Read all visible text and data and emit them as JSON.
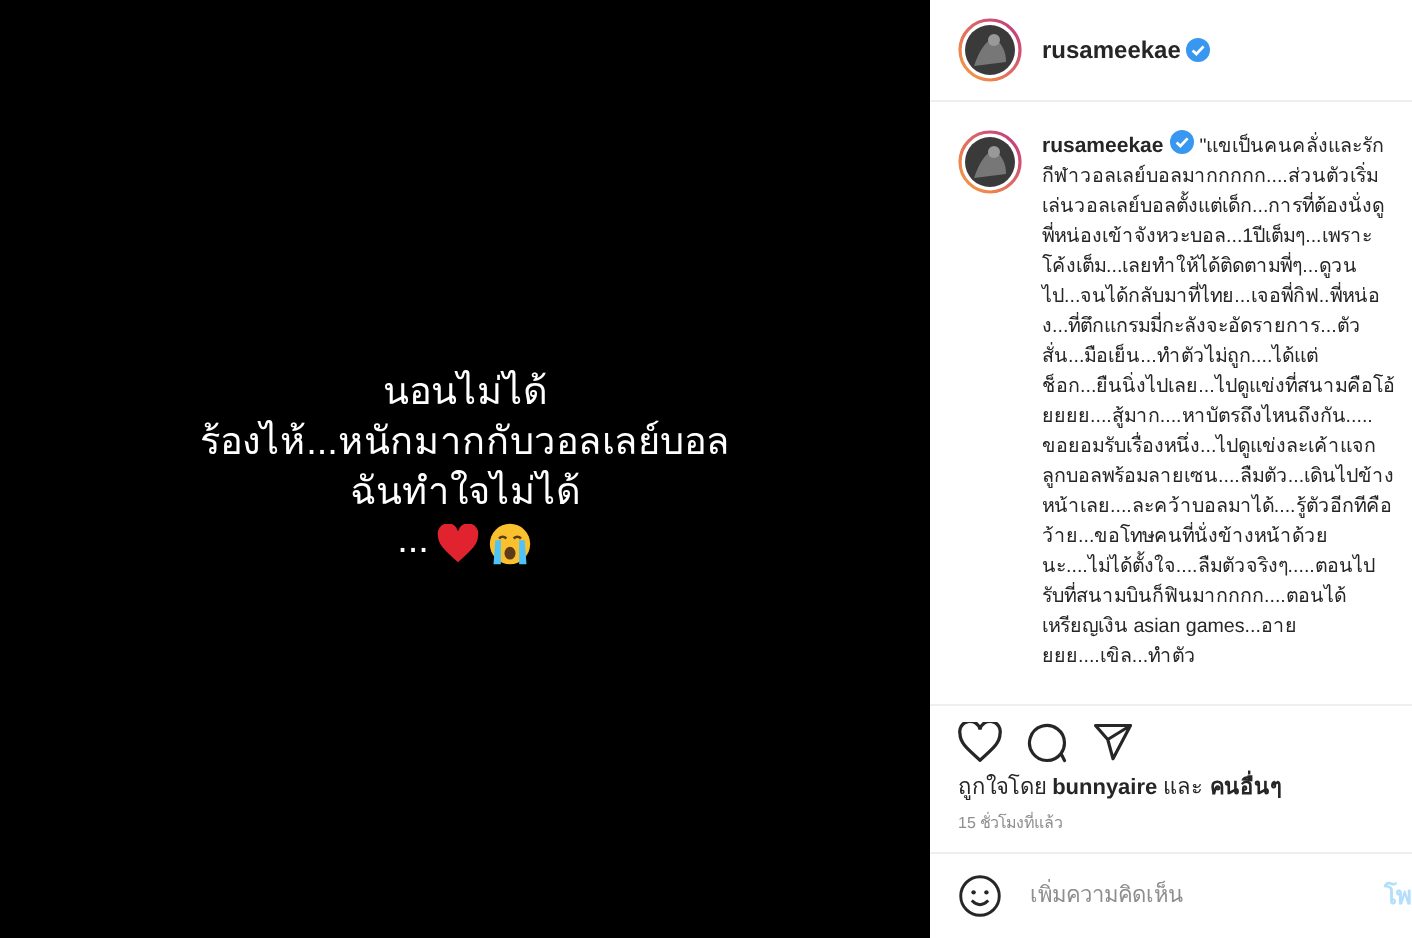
{
  "post_image": {
    "lines": [
      "นอนไม่ได้",
      "ร้องไห้...หนักมากกับวอลเลย์บอล",
      "ฉันทำใจไม่ได้",
      "..."
    ]
  },
  "header": {
    "username": "rusameekae",
    "verified": true
  },
  "caption": {
    "username": "rusameekae",
    "verified": true,
    "text": "\"แขเป็นคนคลั่งและรักกีฬาวอลเลย์บอลมากกกกก....ส่วนตัวเริ่มเล่นวอลเลย์บอลตั้งแต่เด็ก...การที่ต้องนั่งดูพี่หน่องเข้าจังหวะบอล...1ปีเต็มๆ...เพราะโค้งเต็ม...เลยทำให้ได้ติดตามพี่ๆ...ดูวนไป...จนได้กลับมาที่ไทย...เจอพี่กิฟ..พี่หน่อง...ที่ตึกแกรมมี่กะลังจะอัดรายการ...ตัวสั่น...มือเย็น...ทำตัวไม่ถูก....ได้แต่ช็อก...ยืนนิ่งไปเลย...ไปดูแข่งที่สนามคือโอ้ยยยย....สู้มาก....หาบัตรถึงไหนถึงกัน..... ขอยอมรับเรื่องหนึ่ง...ไปดูแข่งละเค้าแจกลูกบอลพร้อมลายเซน....ลืมตัว...เดินไปข้างหน้าเลย....ละคว้าบอลมาได้....รู้ตัวอีกทีคือว้าย...ขอโทษคนที่นั่งข้างหน้าด้วยนะ....ไม่ได้ตั้งใจ....ลืมตัวจริงๆ.....ตอนไปรับที่สนามบินก็ฟินมากกกก....ตอนได้เหรียญเงิน asian games...อายยยย....เขิล...ทำตัว"
  },
  "likes": "ถูกใจโดย **bunnyaire** และ **คนอื่นๆ**",
  "time": "15 ชั่วโมงที่แล้ว",
  "comment": {
    "placeholder": "เพิ่มความคิดเห็น",
    "post_button": "โพ"
  }
}
